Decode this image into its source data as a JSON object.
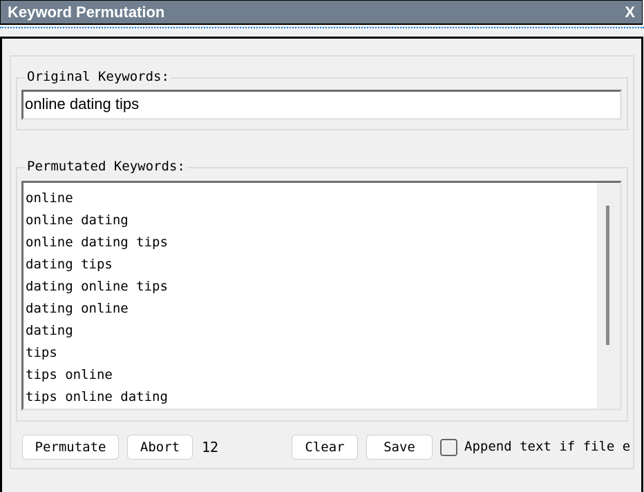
{
  "window": {
    "title": "Keyword Permutation",
    "close_label": "X"
  },
  "original": {
    "legend": "Original Keywords:",
    "value": "online dating tips"
  },
  "permutated": {
    "legend": "Permutated Keywords:",
    "items": [
      "online",
      "online dating",
      "online dating tips",
      "dating tips",
      "dating online tips",
      "dating online",
      "dating",
      "tips",
      "tips online",
      "tips online dating"
    ]
  },
  "actions": {
    "permutate_label": "Permutate",
    "abort_label": "Abort",
    "count": "12",
    "clear_label": "Clear",
    "save_label": "Save",
    "append_label": "Append text if file e",
    "append_checked": false
  }
}
